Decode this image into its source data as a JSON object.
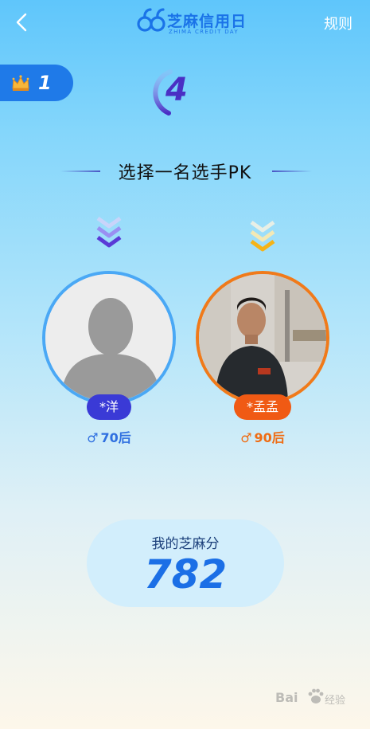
{
  "header": {
    "logo_title": "芝麻信用日",
    "logo_sub": "ZHIMA CREDIT DAY",
    "rules_label": "规则"
  },
  "rank": {
    "value": "1"
  },
  "countdown": {
    "value": "4"
  },
  "prompt": {
    "text": "选择一名选手PK"
  },
  "players": [
    {
      "name": "*洋",
      "age_group": "70后",
      "gender": "♂"
    },
    {
      "name": "*孟孟",
      "age_group": "90后",
      "gender": "♂"
    }
  ],
  "score": {
    "label": "我的芝麻分",
    "value": "782"
  },
  "watermark": {
    "brand": "Bai",
    "sub": "经验"
  },
  "colors": {
    "brand_blue": "#1f7ae8",
    "left_player": "#3a3ad6",
    "right_player": "#f05a14"
  },
  "icons": [
    "back-arrow-icon",
    "zhima-logo-icon",
    "crown-icon",
    "countdown-arc-icon",
    "chevron-down-icon",
    "male-icon",
    "paw-icon"
  ]
}
